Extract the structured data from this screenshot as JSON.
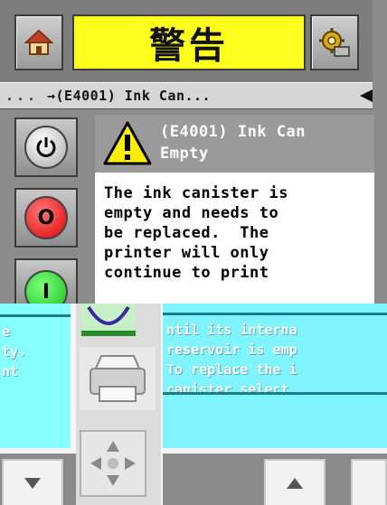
{
  "header": {
    "title": "警告",
    "home_icon": "home-icon",
    "settings_icon": "settings-gear-icon"
  },
  "breadcrumb": {
    "dots": "...",
    "path": "→(E4001) Ink Can...",
    "back_icon": "back-arrow-icon"
  },
  "side_buttons": {
    "power_icon": "power-icon",
    "stop_label": "O",
    "start_label": "I"
  },
  "message": {
    "title_line1": "(E4001) Ink Can",
    "title_line2": "Empty",
    "warning_icon": "warning-triangle-icon",
    "body": "The ink canister is\nempty and needs to\nbe replaced.  The\nprinter will only\ncontinue to print"
  },
  "overlay": {
    "left_text": "e\nty.\nnt",
    "right_text": "ntil its interna\nreservoir is emp\nTo replace the i\ncanister select",
    "icons": [
      "ink-canister-icon",
      "printer-icon",
      "navigation-cross-icon",
      "scroll-down-icon",
      "scroll-up-icon"
    ]
  },
  "colors": {
    "title_bg": "#ffff1e",
    "stop": "#e00000",
    "start": "#18c018",
    "overlay_cyan": "#7ff4ff"
  }
}
